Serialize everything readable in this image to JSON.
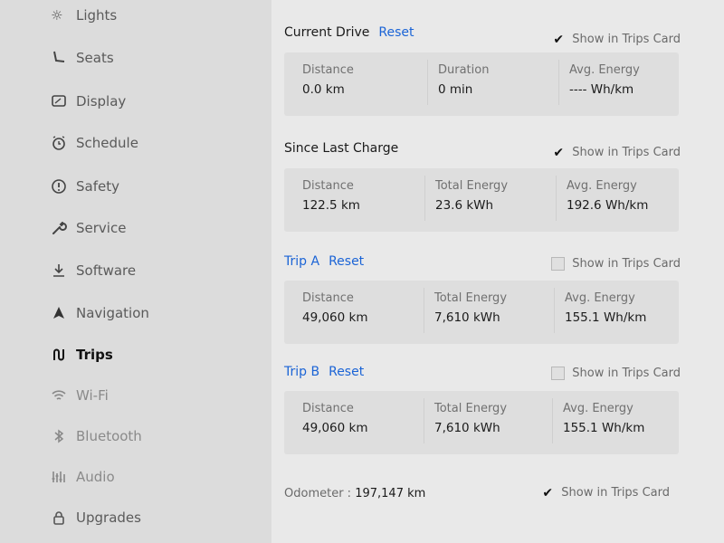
{
  "sidebar": {
    "items": [
      {
        "label": "Lights",
        "icon": "sun-icon"
      },
      {
        "label": "Seats",
        "icon": "seat-icon"
      },
      {
        "label": "Display",
        "icon": "display-icon"
      },
      {
        "label": "Schedule",
        "icon": "alarm-clock-icon"
      },
      {
        "label": "Safety",
        "icon": "alert-circle-icon"
      },
      {
        "label": "Service",
        "icon": "wrench-icon"
      },
      {
        "label": "Software",
        "icon": "download-icon"
      },
      {
        "label": "Navigation",
        "icon": "navigation-arrow-icon"
      },
      {
        "label": "Trips",
        "icon": "trips-icon",
        "active": true
      },
      {
        "label": "Wi-Fi",
        "icon": "wifi-icon"
      },
      {
        "label": "Bluetooth",
        "icon": "bluetooth-icon"
      },
      {
        "label": "Audio",
        "icon": "equalizer-icon"
      },
      {
        "label": "Upgrades",
        "icon": "lock-icon"
      }
    ]
  },
  "sections": {
    "current_drive": {
      "title": "Current Drive",
      "reset": "Reset",
      "show_label": "Show in Trips Card",
      "show_checked": true,
      "stats": [
        {
          "label": "Distance",
          "value": "0.0 km"
        },
        {
          "label": "Duration",
          "value": "0 min"
        },
        {
          "label": "Avg. Energy",
          "value": "---- Wh/km"
        }
      ]
    },
    "since_last_charge": {
      "title": "Since Last Charge",
      "show_label": "Show in Trips Card",
      "show_checked": true,
      "stats": [
        {
          "label": "Distance",
          "value": "122.5 km"
        },
        {
          "label": "Total Energy",
          "value": "23.6 kWh"
        },
        {
          "label": "Avg. Energy",
          "value": "192.6 Wh/km"
        }
      ]
    },
    "trip_a": {
      "title": "Trip A",
      "reset": "Reset",
      "show_label": "Show in Trips Card",
      "show_checked": false,
      "stats": [
        {
          "label": "Distance",
          "value": "49,060 km"
        },
        {
          "label": "Total Energy",
          "value": "7,610 kWh"
        },
        {
          "label": "Avg. Energy",
          "value": "155.1 Wh/km"
        }
      ]
    },
    "trip_b": {
      "title": "Trip B",
      "reset": "Reset",
      "show_label": "Show in Trips Card",
      "show_checked": false,
      "stats": [
        {
          "label": "Distance",
          "value": "49,060 km"
        },
        {
          "label": "Total Energy",
          "value": "7,610 kWh"
        },
        {
          "label": "Avg. Energy",
          "value": "155.1 Wh/km"
        }
      ]
    }
  },
  "odometer": {
    "label": "Odometer :",
    "value": "197,147 km",
    "show_label": "Show in Trips Card",
    "show_checked": true
  },
  "colors": {
    "accent": "#1b64d6",
    "background": "#e9e9e9"
  }
}
